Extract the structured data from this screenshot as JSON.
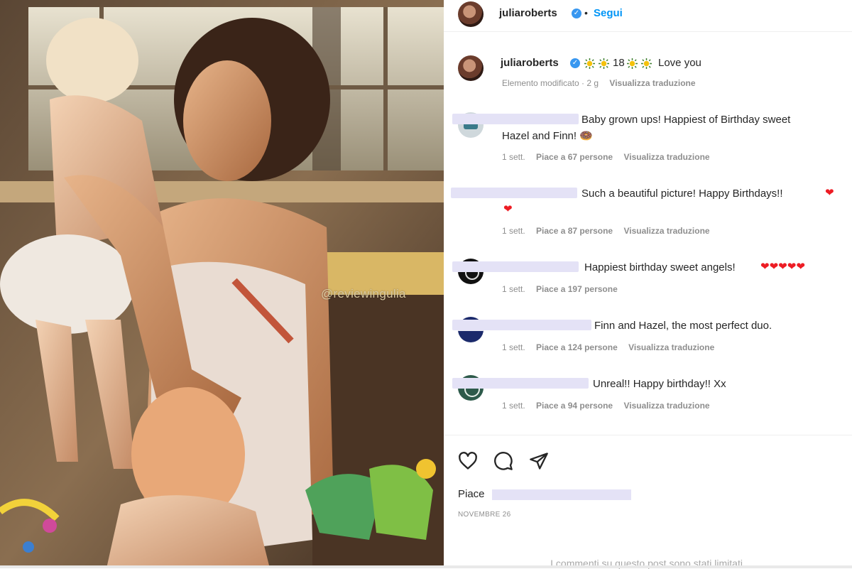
{
  "photo": {
    "watermark": "@reviewingulia"
  },
  "header": {
    "username": "juliaroberts",
    "separator": "•",
    "follow_label": "Segui"
  },
  "caption": {
    "username": "juliaroberts",
    "number": "18",
    "text": "Love you",
    "meta_time": "Elemento modificato · 2 g",
    "meta_translate": "Visualizza traduzione"
  },
  "comments": [
    {
      "text_line1": "Baby grown ups! Happiest of Birthday sweet",
      "text_line2": "Hazel and Finn! 🍩",
      "time": "1 sett.",
      "likes": "Piace a 67 persone",
      "translate": "Visualizza traduzione"
    },
    {
      "text_line1": "Such a beautiful picture! Happy Birthdays!!",
      "time": "1 sett.",
      "likes": "Piace a 87 persone",
      "translate": "Visualizza traduzione"
    },
    {
      "text_line1": "Happiest birthday sweet angels!",
      "time": "1 sett.",
      "likes": "Piace a 197 persone"
    },
    {
      "text_line1": "Finn and Hazel, the most perfect duo.",
      "time": "1 sett.",
      "likes": "Piace a 124 persone",
      "translate": "Visualizza traduzione"
    },
    {
      "text_line1": "Unreal!! Happy birthday!! Xx",
      "time": "1 sett.",
      "likes": "Piace a 94 persone",
      "translate": "Visualizza traduzione"
    }
  ],
  "actions": {
    "like_icon": "heart-outline-icon",
    "comment_icon": "comment-bubble-icon",
    "share_icon": "paper-plane-icon",
    "likes_prefix": "Piace",
    "date": "NOVEMBRE 26"
  },
  "footer": {
    "limited_text": "I commenti su questo post sono stati limitati."
  },
  "colors": {
    "accent": "#0095f6",
    "verified": "#3897f0",
    "heart": "#ed1c24",
    "muted": "#8e8e8e",
    "redaction": "#e4e2f6"
  }
}
